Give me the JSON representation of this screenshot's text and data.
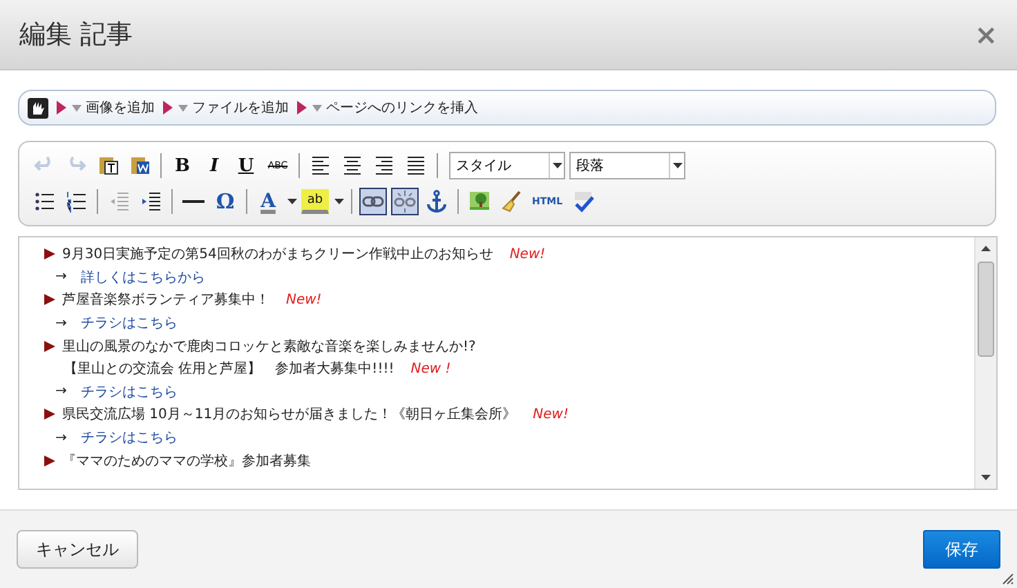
{
  "dialog": {
    "title": "編集 記事",
    "close": "×"
  },
  "insert_bar": [
    {
      "label": "画像を追加"
    },
    {
      "label": "ファイルを追加"
    },
    {
      "label": "ページへのリンクを挿入"
    }
  ],
  "toolbar": {
    "rows": [
      [
        [
          {
            "kind": "undo",
            "disabled": true
          },
          {
            "kind": "redo",
            "disabled": true
          },
          {
            "kind": "paste-text",
            "disabled": false
          },
          {
            "kind": "paste-word",
            "disabled": false
          }
        ],
        [
          {
            "kind": "bold",
            "label": "B",
            "disabled": false
          },
          {
            "kind": "italic",
            "label": "I",
            "disabled": false
          },
          {
            "kind": "underline",
            "label": "U",
            "disabled": false
          },
          {
            "kind": "strike",
            "label": "ABC",
            "disabled": false
          }
        ],
        [
          {
            "kind": "align-left",
            "disabled": false
          },
          {
            "kind": "align-center",
            "disabled": false
          },
          {
            "kind": "align-right",
            "disabled": false
          },
          {
            "kind": "justify",
            "disabled": false
          }
        ]
      ],
      [
        [
          {
            "kind": "bullet-list",
            "disabled": false
          },
          {
            "kind": "number-list",
            "disabled": false
          }
        ],
        [
          {
            "kind": "outdent",
            "disabled": true
          },
          {
            "kind": "indent",
            "disabled": false
          }
        ],
        [
          {
            "kind": "rule",
            "disabled": false
          },
          {
            "kind": "symbol",
            "label": "Ω",
            "disabled": false
          }
        ],
        [
          {
            "kind": "text-color",
            "label": "A",
            "disabled": false
          },
          {
            "kind": "highlight",
            "label": "ab",
            "disabled": false
          }
        ],
        [
          {
            "kind": "link",
            "disabled": false,
            "pressed": true
          },
          {
            "kind": "unlink",
            "disabled": false,
            "pressed": true
          },
          {
            "kind": "anchor",
            "disabled": false,
            "pressed": false
          }
        ],
        [
          {
            "kind": "image",
            "disabled": false
          },
          {
            "kind": "cleanup",
            "disabled": false
          },
          {
            "kind": "html",
            "label": "HTML",
            "disabled": false
          },
          {
            "kind": "spellcheck",
            "disabled": false
          }
        ]
      ]
    ],
    "selects": [
      {
        "value": "スタイル"
      },
      {
        "value": "段落"
      }
    ]
  },
  "content": [
    {
      "kind": "item",
      "text": "9月30日実施予定の第54回秋のわがまちクリーン作戦中止のお知らせ",
      "badge": "New!"
    },
    {
      "kind": "link",
      "arrow": "→",
      "text": "詳しくはこちらから"
    },
    {
      "kind": "item",
      "text": "芦屋音楽祭ボランティア募集中！",
      "badge": "New!"
    },
    {
      "kind": "link",
      "arrow": "→",
      "text": "チラシはこちら"
    },
    {
      "kind": "item",
      "text": "里山の風景のなかで鹿肉コロッケと素敵な音楽を楽しみませんか!?"
    },
    {
      "kind": "note",
      "text": "【里山との交流会 佐用と芦屋】　参加者大募集中!!!!",
      "badge": "New !"
    },
    {
      "kind": "link",
      "arrow": "→",
      "text": "チラシはこちら"
    },
    {
      "kind": "item",
      "text": "県民交流広場 10月～11月のお知らせが届きました！《朝日ヶ丘集会所》",
      "badge": "New!"
    },
    {
      "kind": "link",
      "arrow": "→",
      "text": "チラシはこちら"
    },
    {
      "kind": "item",
      "text": "『ママのためのママの学校』参加者募集"
    }
  ],
  "footer": {
    "cancel": "キャンセル",
    "save": "保存"
  }
}
